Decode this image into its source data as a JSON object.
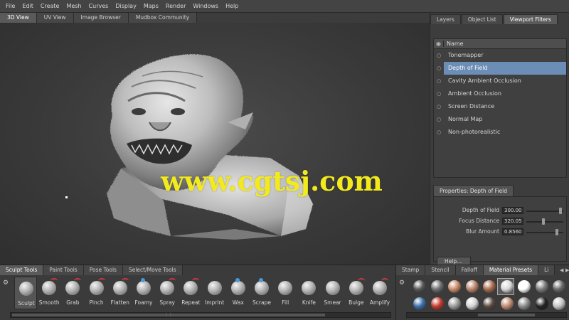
{
  "menu": [
    "File",
    "Edit",
    "Create",
    "Mesh",
    "Curves",
    "Display",
    "Maps",
    "Render",
    "Windows",
    "Help"
  ],
  "view_tabs": [
    "3D View",
    "UV View",
    "Image Browser",
    "Mudbox Community"
  ],
  "watermark": "www.cgtsj.com",
  "right_tabs": [
    "Layers",
    "Object List",
    "Viewport Filters"
  ],
  "filters": {
    "header_name": "Name",
    "eye_icon": "eye-icon",
    "items": [
      {
        "label": "Tonemapper",
        "selected": false
      },
      {
        "label": "Depth of Field",
        "selected": true
      },
      {
        "label": "Cavity Ambient Occlusion",
        "selected": false
      },
      {
        "label": "Ambient Occlusion",
        "selected": false
      },
      {
        "label": "Screen Distance",
        "selected": false
      },
      {
        "label": "Normal Map",
        "selected": false
      },
      {
        "label": "Non-photorealistic",
        "selected": false
      }
    ]
  },
  "properties": {
    "tab": "Properties: Depth of Field",
    "rows": [
      {
        "label": "Depth of Field",
        "value": "300.00",
        "fraction": 0.95
      },
      {
        "label": "Focus Distance",
        "value": "320.05",
        "fraction": 0.45
      },
      {
        "label": "Blur Amount",
        "value": "0.8560",
        "fraction": 0.85
      }
    ],
    "help": "Help..."
  },
  "shelf_tabs": [
    "Sculpt Tools",
    "Paint Tools",
    "Pose Tools",
    "Select/Move Tools"
  ],
  "tools": [
    "Sculpt",
    "Smooth",
    "Grab",
    "Pinch",
    "Flatten",
    "Foamy",
    "Spray",
    "Repeat",
    "Imprint",
    "Wax",
    "Scrape",
    "Fill",
    "Knife",
    "Smear",
    "Bulge",
    "Amplify"
  ],
  "active_tool": "Sculpt",
  "material_tabs": [
    "Stamp",
    "Stencil",
    "Falloff",
    "Material Presets",
    "Li"
  ],
  "materials_row1": [
    "#555555",
    "#6e6e6e",
    "#c98a6a",
    "#b9846a",
    "#a86a4c",
    "#d8d8d8",
    "#ffffff",
    "#7a7a7a",
    "#666666"
  ],
  "materials_row2": [
    "#3a6fa8",
    "#c43a2e",
    "#9a9a9a",
    "#d4d4d4",
    "#5a4a40",
    "#c08a72",
    "#8a8a8a",
    "#222222",
    "#c4c4c4"
  ],
  "colors": {
    "accent_selected": "#6b8db6",
    "watermark": "#f2ea1c",
    "tool_accent": "#d23a3a"
  }
}
